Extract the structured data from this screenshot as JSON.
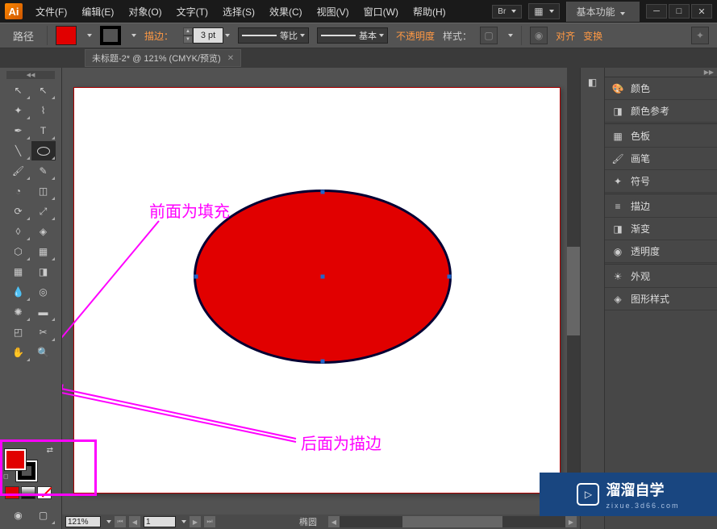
{
  "app": {
    "logo": "Ai"
  },
  "menus": [
    "文件(F)",
    "编辑(E)",
    "对象(O)",
    "文字(T)",
    "选择(S)",
    "效果(C)",
    "视图(V)",
    "窗口(W)",
    "帮助(H)"
  ],
  "workspace_label": "基本功能",
  "control": {
    "context": "路径",
    "stroke_label": "描边：",
    "stroke_width": "3 pt",
    "profile": "等比",
    "brush": "基本",
    "opacity_label": "不透明度",
    "style": "样式：",
    "align": "对齐",
    "transform": "变换"
  },
  "tab": {
    "title": "未标题-2* @ 121% (CMYK/预览)"
  },
  "annotations": {
    "fill_label": "前面为填充",
    "stroke_label": "后面为描边"
  },
  "status": {
    "zoom": "121%",
    "page": "1",
    "selection": "椭圆"
  },
  "panels": [
    "颜色",
    "颜色参考",
    "色板",
    "画笔",
    "符号",
    "描边",
    "渐变",
    "透明度",
    "外观",
    "图形样式"
  ],
  "watermark": {
    "main": "溜溜自学",
    "sub": "zixue.3d66.com"
  },
  "colors": {
    "fill": "#e10000",
    "accent": "#ff9944",
    "magenta": "#ff00ff"
  }
}
